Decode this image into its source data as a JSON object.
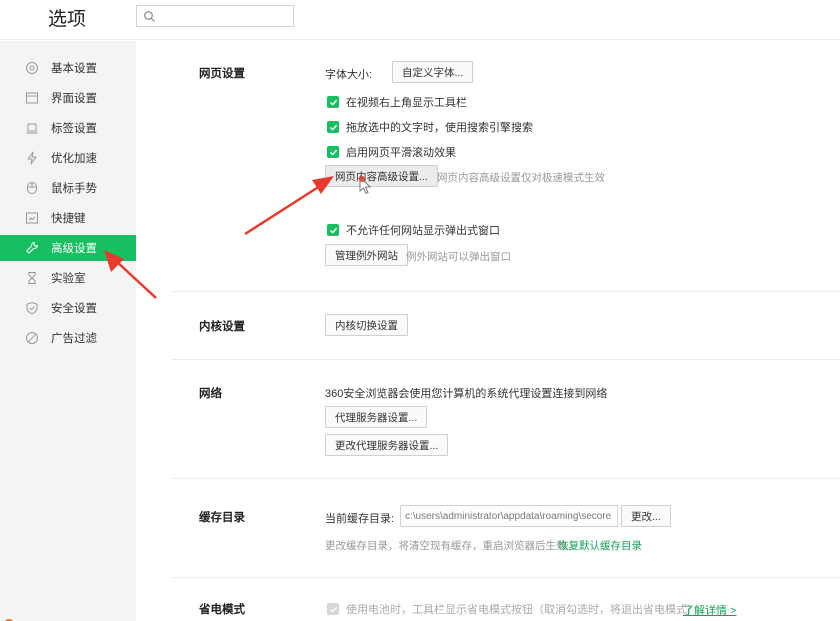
{
  "header": {
    "title": "选项",
    "search_placeholder": ""
  },
  "sidebar": {
    "items": [
      {
        "label": "基本设置",
        "icon": "gear-icon"
      },
      {
        "label": "界面设置",
        "icon": "window-icon"
      },
      {
        "label": "标签设置",
        "icon": "tab-icon"
      },
      {
        "label": "优化加速",
        "icon": "lightning-icon"
      },
      {
        "label": "鼠标手势",
        "icon": "mouse-icon"
      },
      {
        "label": "快捷键",
        "icon": "keyboard-icon"
      },
      {
        "label": "高级设置",
        "icon": "wrench-icon",
        "active": true
      },
      {
        "label": "实验室",
        "icon": "flask-icon"
      },
      {
        "label": "安全设置",
        "icon": "shield-icon"
      },
      {
        "label": "广告过滤",
        "icon": "block-icon"
      }
    ],
    "accent": "#16c061"
  },
  "webpage": {
    "title": "网页设置",
    "font_size_label": "字体大小:",
    "custom_font_button": "自定义字体...",
    "checks": [
      "在视频右上角显示工具栏",
      "拖放选中的文字时，使用搜索引擎搜索",
      "启用网页平滑滚动效果"
    ],
    "advanced_button": "网页内容高级设置...",
    "advanced_hint": "网页内容高级设置仅对极速模式生效",
    "popup_check": "不允许任何网站显示弹出式窗口",
    "exceptions_button": "管理例外网站",
    "exceptions_hint": "例外网站可以弹出窗口"
  },
  "kernel": {
    "title": "内核设置",
    "switch_button": "内核切换设置"
  },
  "network": {
    "title": "网络",
    "description": "360安全浏览器会使用您计算机的系统代理设置连接到网络",
    "proxy_button": "代理服务器设置...",
    "change_proxy_button": "更改代理服务器设置..."
  },
  "cache": {
    "title": "缓存目录",
    "current_label": "当前缓存目录:",
    "path_value": "c:\\users\\administrator\\appdata\\roaming\\secore",
    "change_button": "更改...",
    "hint": "更改缓存目录，将清空现有缓存，重启浏览器后生效。",
    "restore_link": "恢复默认缓存目录"
  },
  "power": {
    "title": "省电模式",
    "check": "使用电池时，工具栏显示省电模式按钮（取消勾选时，将退出省电模式）",
    "learn_more": "了解详情 >"
  },
  "colors": {
    "accent": "#16c061",
    "annotation": "#e8392f"
  }
}
